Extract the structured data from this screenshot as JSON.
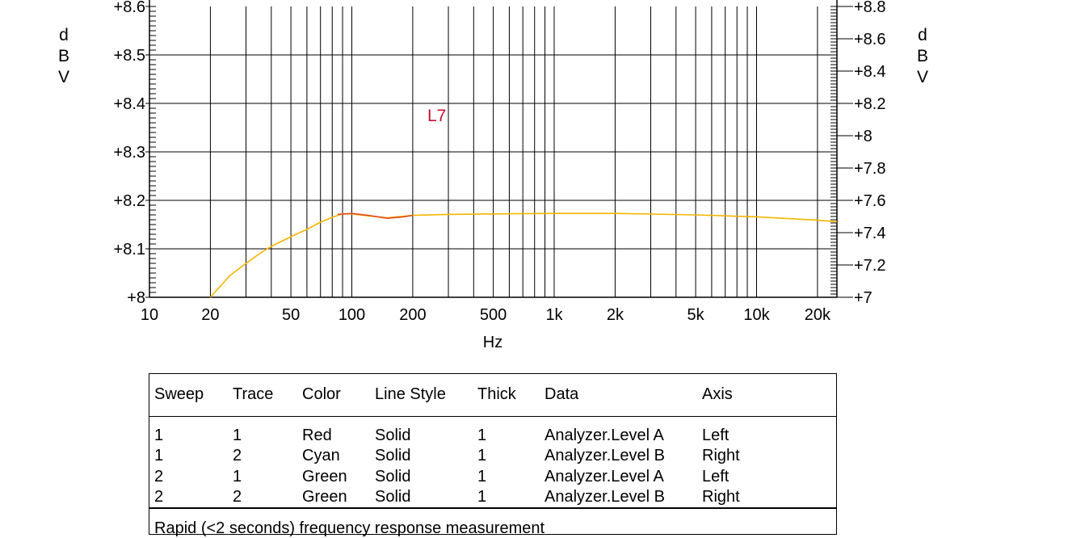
{
  "chart_data": {
    "type": "line",
    "xlabel": "Hz",
    "x_scale": "log",
    "xlim": [
      10,
      25000
    ],
    "x_ticks": [
      {
        "value": 10,
        "label": "10"
      },
      {
        "value": 20,
        "label": "20"
      },
      {
        "value": 50,
        "label": "50"
      },
      {
        "value": 100,
        "label": "100"
      },
      {
        "value": 200,
        "label": "200"
      },
      {
        "value": 500,
        "label": "500"
      },
      {
        "value": 1000,
        "label": "1k"
      },
      {
        "value": 2000,
        "label": "2k"
      },
      {
        "value": 5000,
        "label": "5k"
      },
      {
        "value": 10000,
        "label": "10k"
      },
      {
        "value": 20000,
        "label": "20k"
      }
    ],
    "ylabel_left": "dBV",
    "ylim_left": [
      8.0,
      8.6
    ],
    "y_ticks_left": [
      "+8",
      "+8.1",
      "+8.2",
      "+8.3",
      "+8.4",
      "+8.5",
      "+8.6"
    ],
    "ylabel_right": "dBV",
    "ylim_right": [
      7.0,
      8.8
    ],
    "y_ticks_right": [
      "+7",
      "+7.2",
      "+7.4",
      "+7.6",
      "+7.8",
      "+8",
      "+8.2",
      "+8.4",
      "+8.6",
      "+8.8"
    ],
    "grid": true,
    "annotation": "L7",
    "series": [
      {
        "color": "#f7b500",
        "axis": "left",
        "x": [
          20,
          25,
          30,
          35,
          40,
          50,
          60,
          70,
          80,
          90,
          100,
          120,
          150,
          200,
          300,
          500,
          1000,
          2000,
          5000,
          10000,
          15000,
          20000,
          25000
        ],
        "y": [
          8.0,
          8.045,
          8.07,
          8.09,
          8.105,
          8.125,
          8.14,
          8.155,
          8.165,
          8.172,
          8.172,
          8.168,
          8.164,
          8.169,
          8.171,
          8.172,
          8.173,
          8.173,
          8.17,
          8.166,
          8.162,
          8.159,
          8.156
        ]
      },
      {
        "color": "#e34a1a",
        "axis": "left",
        "x": [
          85,
          100,
          120,
          150,
          180,
          200
        ],
        "y": [
          8.171,
          8.173,
          8.169,
          8.163,
          8.166,
          8.169
        ]
      }
    ]
  },
  "legend_table": {
    "headers": [
      "Sweep",
      "Trace",
      "Color",
      "Line Style",
      "Thick",
      "Data",
      "Axis"
    ],
    "rows": [
      [
        "1",
        "1",
        "Red",
        "Solid",
        "1",
        "Analyzer.Level A",
        "Left"
      ],
      [
        "1",
        "2",
        "Cyan",
        "Solid",
        "1",
        "Analyzer.Level B",
        "Right"
      ],
      [
        "2",
        "1",
        "Green",
        "Solid",
        "1",
        "Analyzer.Level A",
        "Left"
      ],
      [
        "2",
        "2",
        "Green",
        "Solid",
        "1",
        "Analyzer.Level B",
        "Right"
      ]
    ],
    "footer": "Rapid (<2 seconds) frequency response measurement"
  }
}
